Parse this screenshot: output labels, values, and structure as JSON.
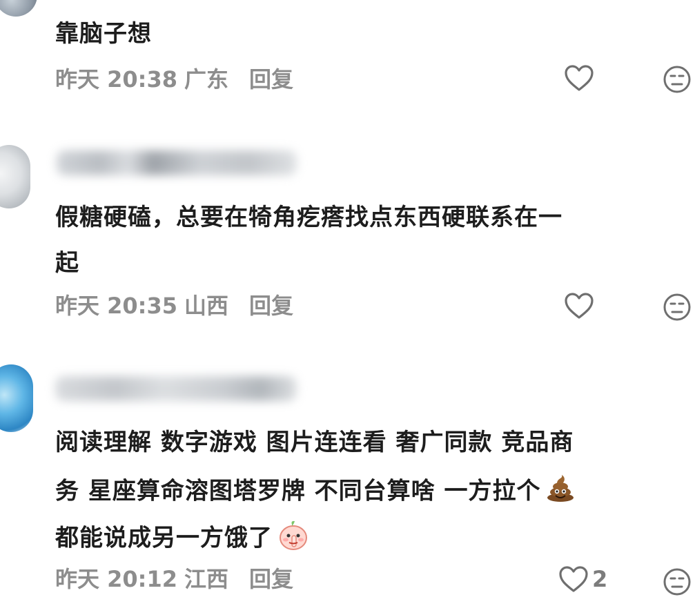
{
  "comments": [
    {
      "text": "靠脑子想",
      "time": "昨天 20:38",
      "location": "广东",
      "reply_label": "回复",
      "likes": ""
    },
    {
      "text_line1": "假糖硬磕，总要在犄角疙瘩找点东西硬联系在一",
      "text_line2": "起",
      "time": "昨天 20:35",
      "location": "山西",
      "reply_label": "回复",
      "likes": ""
    },
    {
      "text_line1": "阅读理解 数字游戏 图片连连看 奢广同款 竞品商",
      "text_line2": "务 星座算命溶图塔罗牌 不同台算啥 一方拉个",
      "text_line3": "都能说成另一方饿了",
      "time": "昨天 20:12",
      "location": "江西",
      "reply_label": "回复",
      "likes": "2"
    }
  ],
  "icons": {
    "like": "heart-outline-icon",
    "dislike": "unamused-face-icon",
    "poop_emoji": "poop-emoji",
    "shush_emoji": "shushing-peach-emoji"
  },
  "colors": {
    "text": "#1d1d1d",
    "meta": "#8d8d8d",
    "icon": "#6f6f6f"
  }
}
